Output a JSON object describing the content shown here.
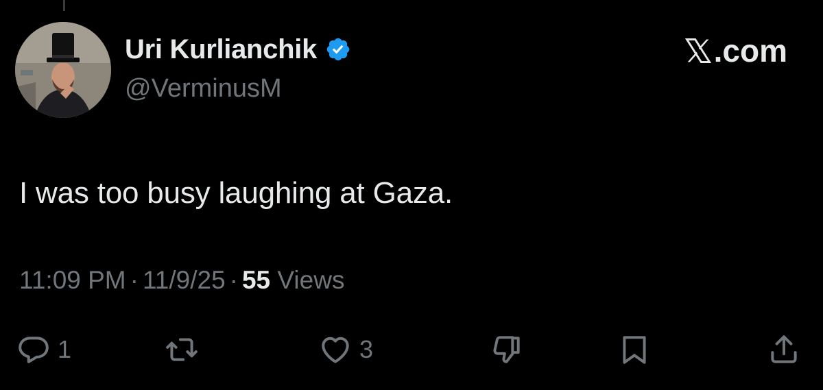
{
  "profile": {
    "display_name": "Uri Kurlianchik",
    "handle": "@VerminusM",
    "verified": true,
    "verified_color": "#1d9bf0"
  },
  "site": {
    "logo_text": ".com",
    "logo_icon": "x-logo-icon"
  },
  "tweet": {
    "text": "I was too busy laughing at Gaza.",
    "time": "11:09 PM",
    "date": "11/9/25",
    "separator": "·",
    "views_count": "55",
    "views_label": "Views"
  },
  "actions": {
    "reply": {
      "icon": "reply-icon",
      "count": "1"
    },
    "repost": {
      "icon": "repost-icon",
      "count": ""
    },
    "like": {
      "icon": "heart-icon",
      "count": "3"
    },
    "dislike": {
      "icon": "thumbs-down-icon",
      "count": ""
    },
    "bookmark": {
      "icon": "bookmark-icon",
      "count": ""
    },
    "share": {
      "icon": "share-icon",
      "count": ""
    }
  },
  "colors": {
    "background": "#000000",
    "primary_text": "#e7e9ea",
    "secondary_text": "#71767b"
  }
}
